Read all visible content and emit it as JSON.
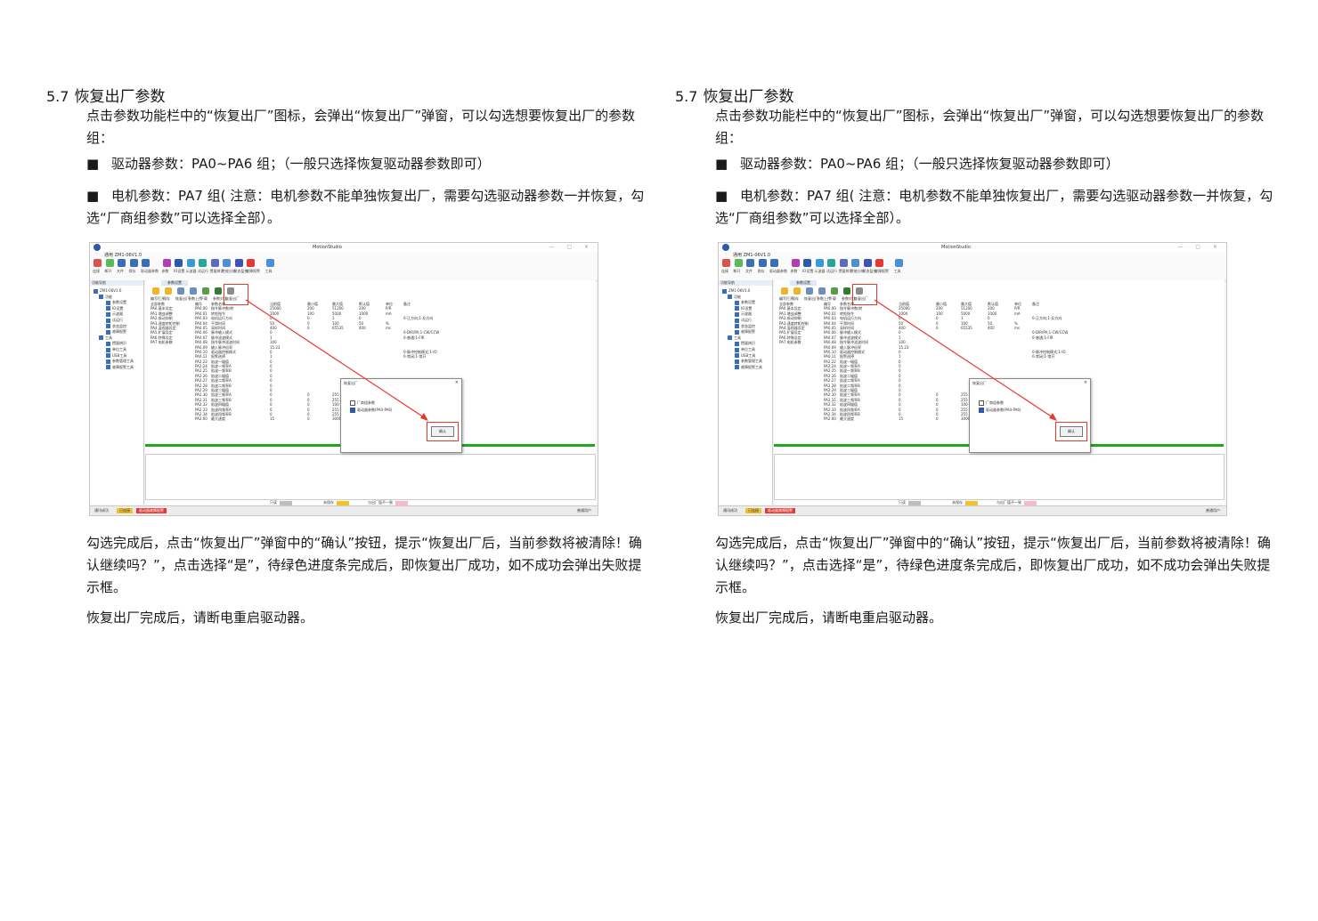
{
  "section": {
    "number": "5.7",
    "title": "恢复出厂参数"
  },
  "intro": "点击参数功能栏中的“恢复出厂”图标，会弹出“恢复出厂”弹窗，可以勾选想要恢复出厂的参数组：",
  "bullets": [
    "驱动器参数：PA0~PA6 组；（一般只选择恢复驱动器参数即可）",
    "电机参数：PA7 组( 注意：电机参数不能单独恢复出厂，需要勾选驱动器参数一并恢复，勾选“厂商组参数”可以选择全部）。"
  ],
  "after_confirm": "勾选完成后，点击“恢复出厂”弹窗中的“确认”按钮，提示“恢复出厂后，当前参数将被清除！确认继续吗？”，点击选择“是”，待绿色进度条完成后，即恢复出厂成功，如不成功会弹出失败提示框。",
  "final_note": "恢复出厂完成后，请断电重启驱动器。",
  "screenshot": {
    "app_title": "MotionStudio",
    "ribbon_tabs": "通用    ZM1-06V1.0",
    "ribbon_items": [
      "连接",
      "断开",
      "文件",
      "保存",
      "驱动器参数",
      "参数",
      "IO设置",
      "示波器",
      "试运行",
      "惯量辨识",
      "性能分析",
      "状态监控",
      "故障报警",
      "工具"
    ],
    "nav_header": "功能导航",
    "nav_items": [
      "ZM1-06V1.0",
      "功能",
      "参数设置",
      "IO设置",
      "示波器",
      "试运行",
      "状态监控",
      "故障报警",
      "工具",
      "惯量辨识",
      "单位工具",
      "USB工具",
      "参数管理工具",
      "故障报警工具"
    ],
    "doc_tab": "参数设置",
    "toolbar": [
      "编写打开",
      "保存",
      "恢复出厂",
      "参数上传",
      "下载",
      "参数对比",
      "恢复出厂"
    ],
    "groups": [
      "全部参数",
      "PA0.基本设定",
      "PA1.增益调整",
      "PA2.振动抑制",
      "PA3.速度转矩控制",
      "PA4.监视器设定",
      "PA5.扩展设定",
      "PA6.特殊设定",
      "PA7.电机参数"
    ],
    "headers": [
      "编号",
      "参数名称",
      "当前值",
      "最小值",
      "最大值",
      "默认值",
      "单位",
      "备注"
    ],
    "rows": [
      [
        "PA0.00",
        "指令脉冲数/转",
        "25000",
        "200",
        "51200",
        "200",
        "P/R",
        ""
      ],
      [
        "PA0.01",
        "转矩指令",
        "1000",
        "100",
        "5000",
        "1000",
        "mA",
        ""
      ],
      [
        "PA0.03",
        "电机运行方向",
        "0",
        "0",
        "1",
        "0",
        "",
        "0-正方向;1-反方向"
      ],
      [
        "PA0.04",
        "平滑时间",
        "50",
        "0",
        "100",
        "50",
        "%",
        ""
      ],
      [
        "PA0.05",
        "采样时间",
        "400",
        "0",
        "65535",
        "400",
        "ms",
        ""
      ],
      [
        "PA0.06",
        "脉冲输入模式",
        "0",
        "",
        "",
        "",
        "",
        "0-DIR/PA;1-CW/CCW"
      ],
      [
        "PA0.07",
        "脉冲滤波模式",
        "1",
        "",
        "",
        "",
        "",
        "0-普通;1-FIR"
      ],
      [
        "PA0.08",
        "指令脉冲滤波时间",
        "100",
        "",
        "",
        "",
        "",
        ""
      ],
      [
        "PA0.09",
        "输入脉冲倍率",
        "15.23",
        "",
        "",
        "",
        "",
        ""
      ],
      [
        "PA0.10",
        "驱动器控制模式",
        "0",
        "",
        "",
        "",
        "",
        "0-脉冲控制模式;1-IO"
      ],
      [
        "PA0.11",
        "报警选择",
        "1",
        "",
        "",
        "",
        "",
        "0-常闭;1-常开"
      ],
      [
        "PA2.22",
        "陷波一幅值",
        "0",
        "",
        "",
        "",
        "",
        ""
      ],
      [
        "PA2.24",
        "陷波一频率A",
        "0",
        "",
        "",
        "",
        "",
        ""
      ],
      [
        "PA2.25",
        "陷波一频率B",
        "0",
        "",
        "",
        "",
        "",
        ""
      ],
      [
        "PA2.26",
        "陷波二幅值",
        "0",
        "",
        "",
        "",
        "",
        ""
      ],
      [
        "PA2.27",
        "陷波二频率A",
        "0",
        "",
        "",
        "",
        "",
        ""
      ],
      [
        "PA2.28",
        "陷波二频率B",
        "0",
        "",
        "",
        "",
        "",
        ""
      ],
      [
        "PA2.29",
        "陷波三幅值",
        "0",
        "",
        "",
        "",
        "",
        ""
      ],
      [
        "PA2.30",
        "陷波三频率A",
        "0",
        "0",
        "255",
        "0",
        "",
        ""
      ],
      [
        "PA2.31",
        "陷波三频率B",
        "0",
        "0",
        "255",
        "0",
        "",
        ""
      ],
      [
        "PA2.32",
        "陷波四幅值",
        "0",
        "0",
        "100",
        "0",
        "",
        ""
      ],
      [
        "PA2.33",
        "陷波四频率A",
        "0",
        "0",
        "255",
        "0",
        "",
        ""
      ],
      [
        "PA2.34",
        "陷波四频率B",
        "0",
        "0",
        "255",
        "0",
        "",
        ""
      ],
      [
        "PA2.00",
        "最大速度",
        "15",
        "0",
        "3000",
        "15",
        "rpm",
        ""
      ]
    ],
    "dialog": {
      "title": "恢复出厂",
      "close": "×",
      "check1": "厂商组参数",
      "check2": "驱动器参数(PA0-PA6)",
      "ok": "确认"
    },
    "legend": [
      {
        "label": "只读",
        "color": "#bdbdbd"
      },
      {
        "label": "未保存",
        "color": "#f2c12e"
      },
      {
        "label": "与出厂值不一致",
        "color": "#f7b8cf"
      }
    ],
    "status": {
      "left": "通讯成功",
      "mid": "已连接",
      "red": "驱动器故障报警",
      "right": "普通用户"
    },
    "highlight_color": "#e8382d",
    "progress_color": "#1ea81e"
  }
}
